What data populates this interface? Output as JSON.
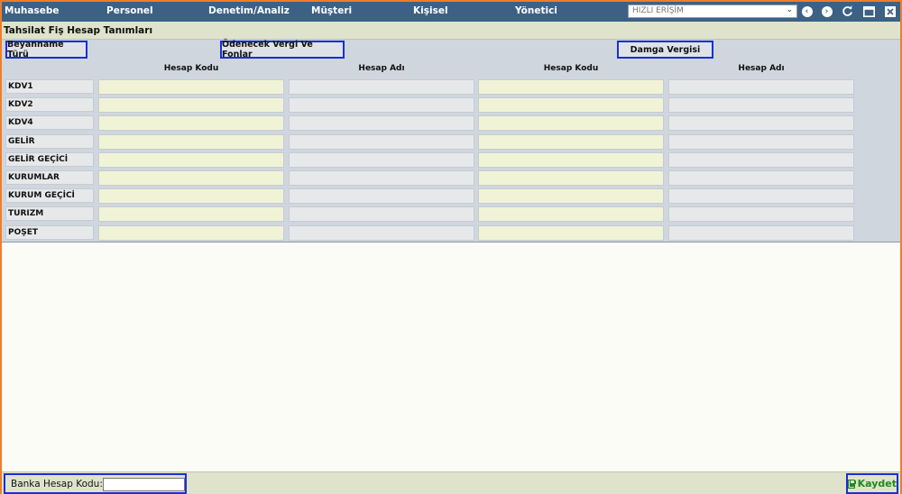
{
  "menu": [
    "Muhasebe",
    "Personel",
    "Denetim/Analiz",
    "Müşteri",
    "Kişisel",
    "Yönetici"
  ],
  "quick_access": {
    "placeholder": "HIZLI ERİŞİM"
  },
  "toolbar_icons": [
    "back-icon",
    "forward-icon",
    "refresh-icon",
    "maximize-icon",
    "close-icon"
  ],
  "page_title": "Tahsilat Fiş Hesap Tanımları",
  "groups": {
    "beyanname": "Beyanname Türü",
    "odenecek": "Ödenecek Vergi Ve Fonlar",
    "damga": "Damga Vergisi"
  },
  "columns": [
    "Hesap Kodu",
    "Hesap Adı",
    "Hesap Kodu",
    "Hesap Adı"
  ],
  "rows": [
    "KDV1",
    "KDV2",
    "KDV4",
    "GELİR",
    "GELİR GEÇİCİ",
    "KURUMLAR",
    "KURUM GEÇİCİ",
    "TURIZM",
    "POŞET"
  ],
  "footer": {
    "bank_label": "Banka Hesap Kodu:",
    "bank_value": "",
    "save_label": "Kaydet"
  },
  "colors": {
    "topbar": "#3d6185",
    "frame": "#f07d2a",
    "highlight_border": "#1a2fd6",
    "code_cell": "#f1f3d6",
    "save_text": "#1e8a1e"
  }
}
